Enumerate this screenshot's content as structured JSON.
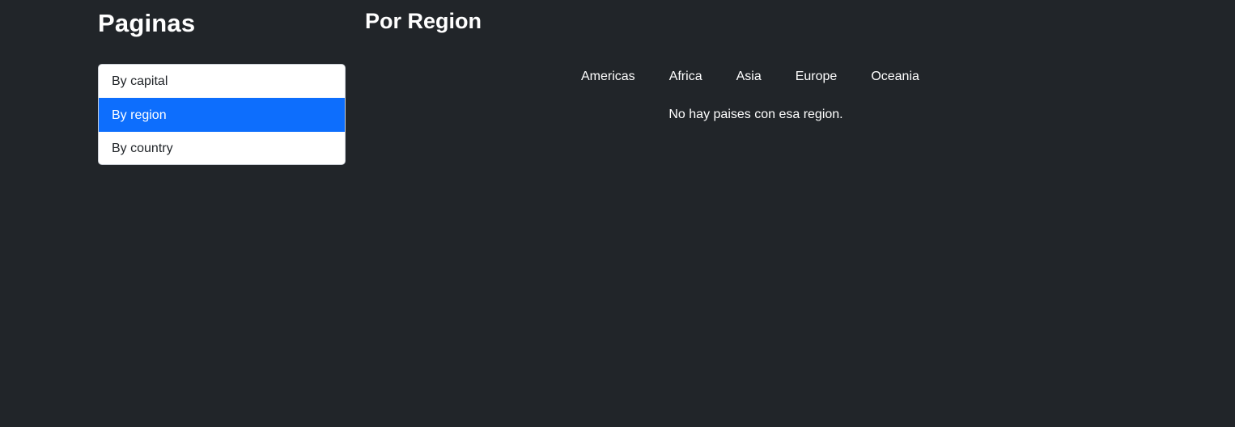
{
  "sidebar": {
    "title": "Paginas",
    "items": [
      {
        "label": "By capital",
        "active": false
      },
      {
        "label": "By region",
        "active": true
      },
      {
        "label": "By country",
        "active": false
      }
    ]
  },
  "main": {
    "title": "Por Region",
    "regions": [
      "Americas",
      "Africa",
      "Asia",
      "Europe",
      "Oceania"
    ],
    "empty_message": "No hay paises con esa region."
  },
  "colors": {
    "background": "#212529",
    "accent": "#0d6efd",
    "text": "#ffffff"
  }
}
